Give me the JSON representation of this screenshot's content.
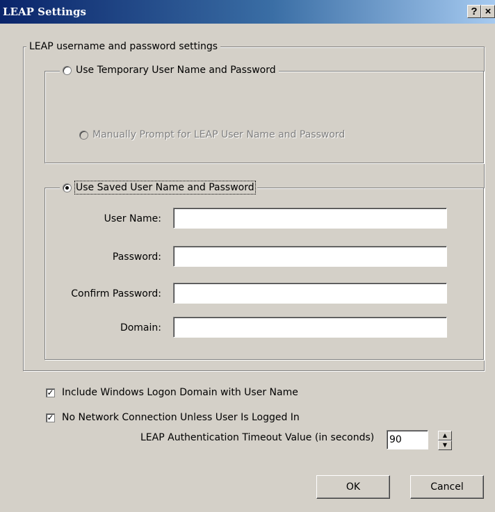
{
  "window": {
    "title": "LEAP Settings",
    "help_button": "?",
    "close_button": "×"
  },
  "outer_group": {
    "label": "LEAP username and password settings"
  },
  "temporary_group": {
    "label": "Use Temporary User Name and Password",
    "selected": false,
    "manual_prompt": {
      "label": "Manually Prompt for LEAP User Name and Password",
      "enabled": false,
      "selected": false
    }
  },
  "saved_group": {
    "label": "Use Saved User Name and Password",
    "selected": true,
    "fields": {
      "username": {
        "label": "User Name:",
        "value": ""
      },
      "password": {
        "label": "Password:",
        "value": ""
      },
      "confirm_password": {
        "label": "Confirm Password:",
        "value": ""
      },
      "domain": {
        "label": "Domain:",
        "value": ""
      }
    }
  },
  "options": {
    "include_domain": {
      "label": "Include Windows Logon Domain with User Name",
      "checked": true
    },
    "no_network": {
      "label": "No Network Connection Unless User Is Logged In",
      "checked": true
    }
  },
  "timeout": {
    "label": "LEAP Authentication Timeout Value (in seconds)",
    "value": "90"
  },
  "buttons": {
    "ok": "OK",
    "cancel": "Cancel"
  }
}
